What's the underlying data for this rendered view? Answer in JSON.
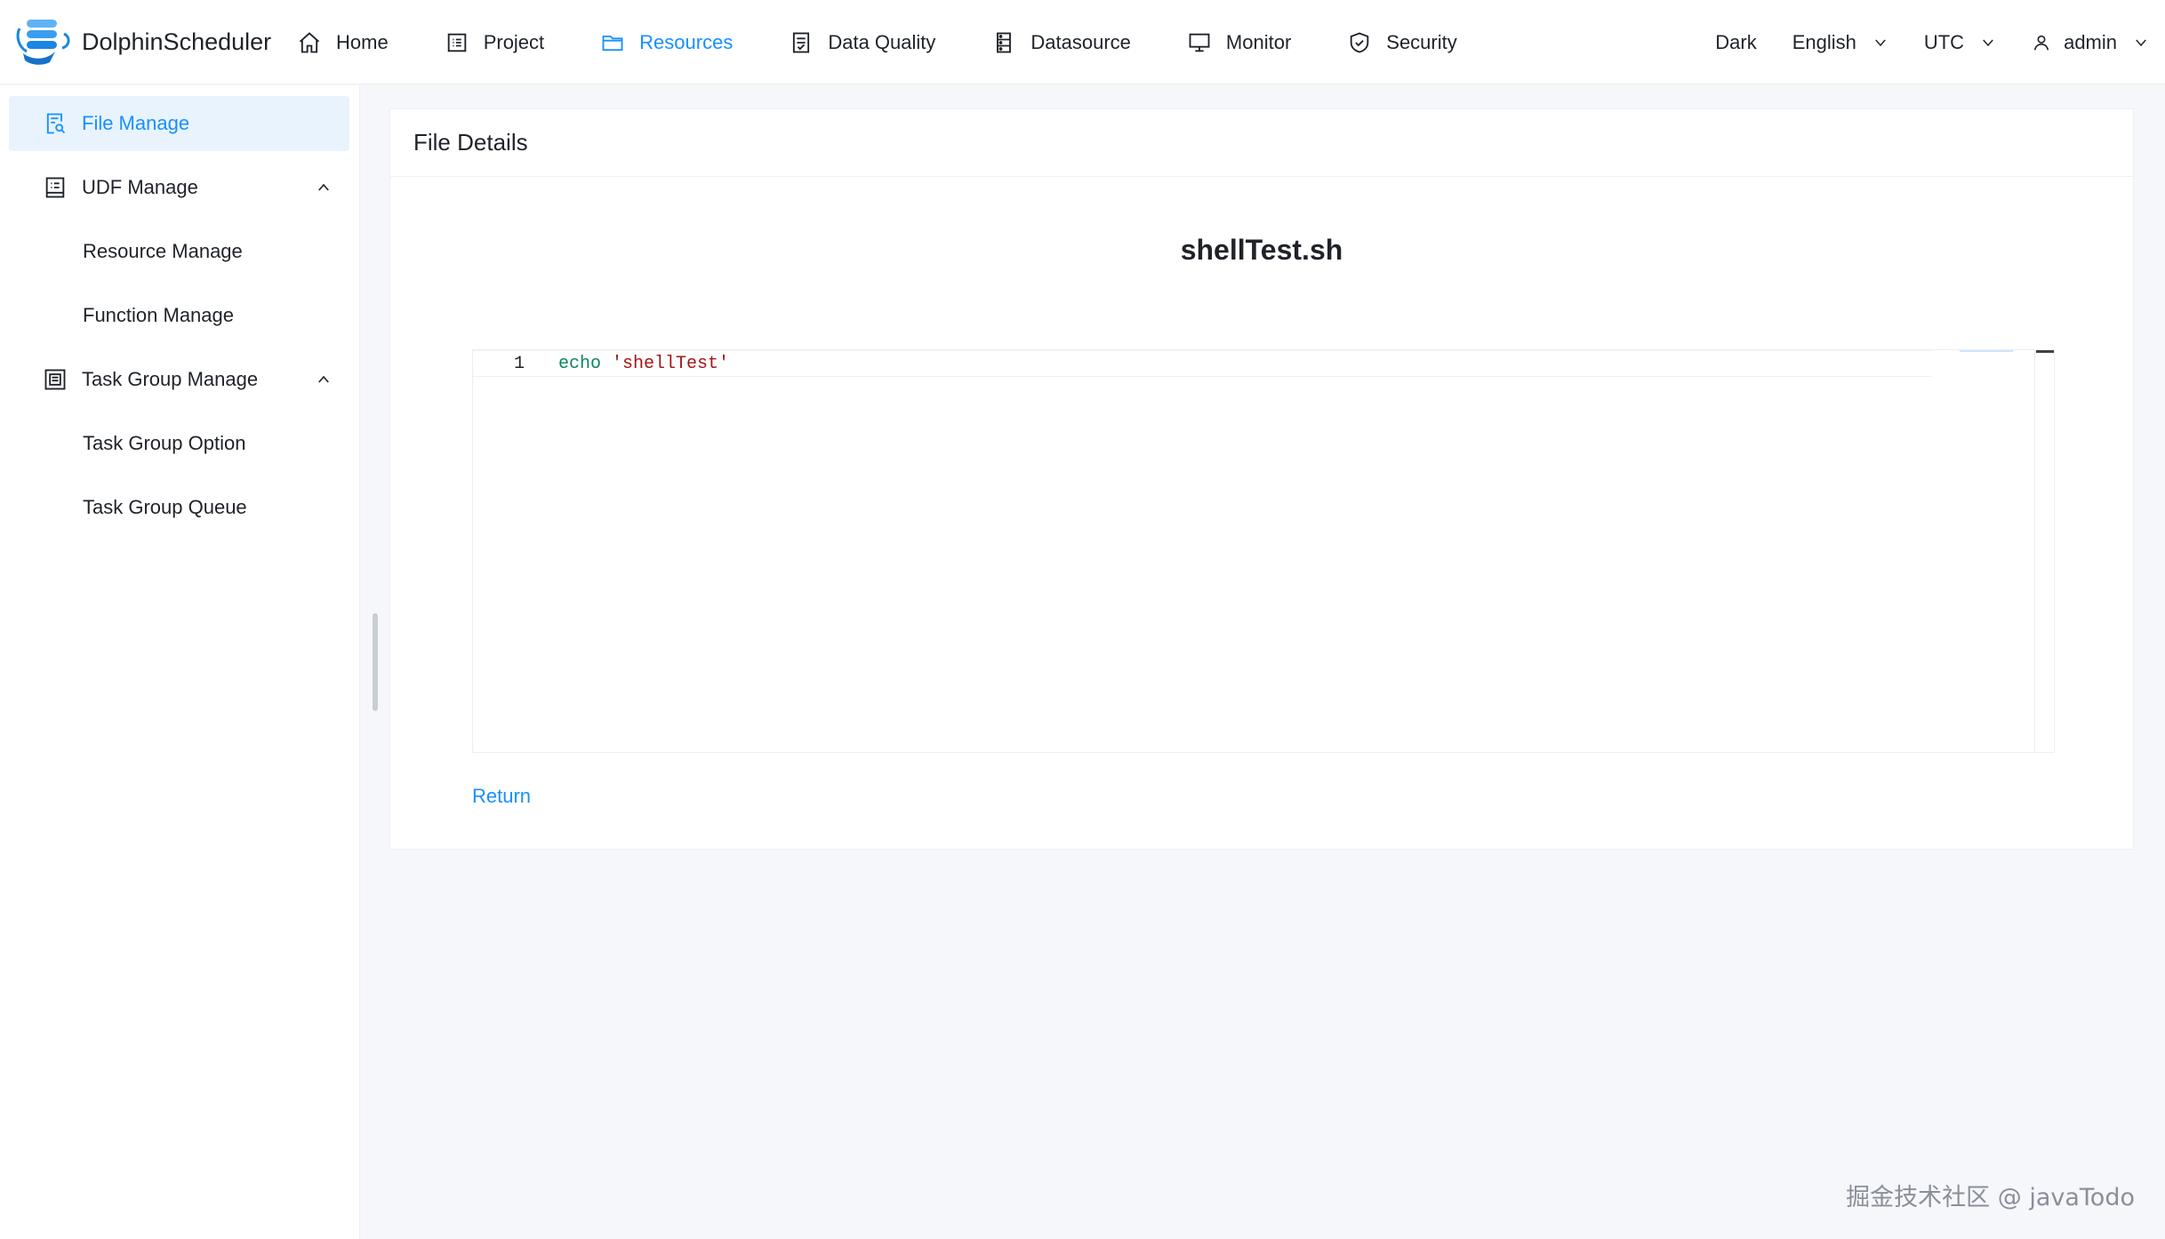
{
  "app": {
    "name": "DolphinScheduler"
  },
  "nav": {
    "items": [
      {
        "label": "Home",
        "icon": "home-icon"
      },
      {
        "label": "Project",
        "icon": "project-icon"
      },
      {
        "label": "Resources",
        "icon": "folder-icon",
        "active": true
      },
      {
        "label": "Data Quality",
        "icon": "data-quality-icon"
      },
      {
        "label": "Datasource",
        "icon": "datasource-icon"
      },
      {
        "label": "Monitor",
        "icon": "monitor-icon"
      },
      {
        "label": "Security",
        "icon": "shield-icon"
      }
    ]
  },
  "header_tools": {
    "theme": "Dark",
    "language": "English",
    "timezone": "UTC",
    "user": "admin"
  },
  "sidebar": {
    "items": [
      {
        "label": "File Manage",
        "active": true,
        "icon": "file-search-icon"
      },
      {
        "label": "UDF Manage",
        "icon": "udf-icon",
        "expanded": true
      },
      {
        "label": "Resource Manage"
      },
      {
        "label": "Function Manage"
      },
      {
        "label": "Task Group Manage",
        "icon": "task-group-icon",
        "expanded": true
      },
      {
        "label": "Task Group Option"
      },
      {
        "label": "Task Group Queue"
      }
    ]
  },
  "main": {
    "card_title": "File Details",
    "file_name": "shellTest.sh",
    "editor": {
      "lines": [
        {
          "number": "1",
          "keyword": "echo",
          "string": "'shellTest'"
        }
      ]
    },
    "return_label": "Return"
  },
  "watermark": "掘金技术社区 @ javaTodo",
  "colors": {
    "accent": "#1890ff",
    "active_bg": "#e8f3fe",
    "page_bg": "#f5f7fa"
  }
}
